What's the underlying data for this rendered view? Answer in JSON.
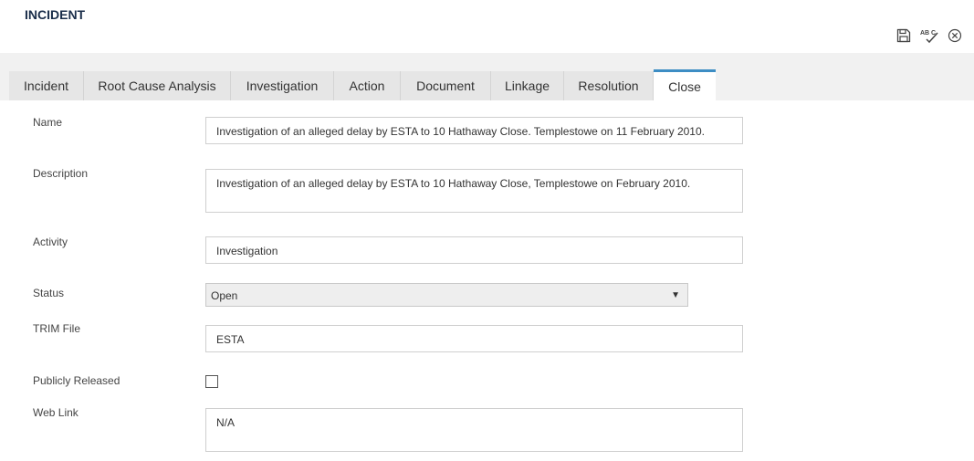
{
  "header": {
    "title": "INCIDENT"
  },
  "toolbar": [
    {
      "icon": "save-icon"
    },
    {
      "icon": "spellcheck-icon",
      "glyph_text": "AB C"
    },
    {
      "icon": "close-circle-icon"
    }
  ],
  "tabs": [
    {
      "label": "Incident",
      "active": false
    },
    {
      "label": "Root Cause Analysis",
      "active": false
    },
    {
      "label": "Investigation",
      "active": false
    },
    {
      "label": "Action",
      "active": false
    },
    {
      "label": "Document",
      "active": false
    },
    {
      "label": "Linkage",
      "active": false
    },
    {
      "label": "Resolution",
      "active": false
    },
    {
      "label": "Close",
      "active": true
    }
  ],
  "form": {
    "name": {
      "label": "Name",
      "value": "Investigation of an alleged delay by ESTA to 10 Hathaway Close. Templestowe on 11 February 2010."
    },
    "description": {
      "label": "Description",
      "value": "Investigation of an alleged delay by ESTA to 10 Hathaway Close, Templestowe on February 2010."
    },
    "activity": {
      "label": "Activity",
      "value": "Investigation"
    },
    "status": {
      "label": "Status",
      "value": "Open"
    },
    "trim_file": {
      "label": "TRIM File",
      "value": "ESTA"
    },
    "publicly_released": {
      "label": "Publicly Released",
      "checked": false
    },
    "web_link": {
      "label": "Web Link",
      "value": "N/A"
    }
  },
  "colors": {
    "accent": "#3d8dc4",
    "title": "#1a2e4a",
    "tab_bg": "#e6e6e6",
    "tabbar_bg": "#f1f1f1"
  }
}
